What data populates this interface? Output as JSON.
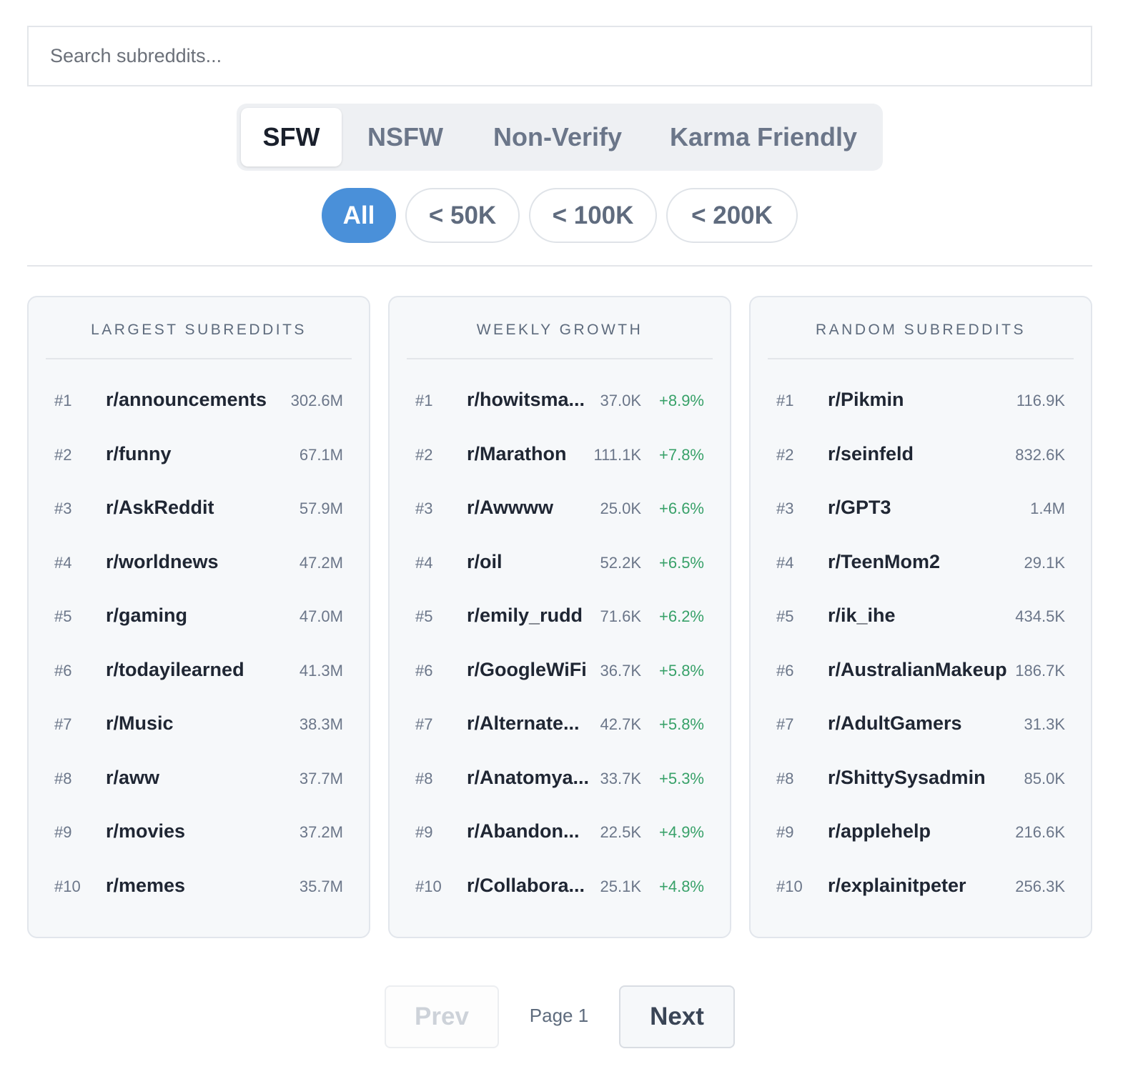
{
  "search": {
    "placeholder": "Search subreddits...",
    "value": ""
  },
  "tabs": [
    {
      "label": "SFW",
      "active": true
    },
    {
      "label": "NSFW",
      "active": false
    },
    {
      "label": "Non-Verify",
      "active": false
    },
    {
      "label": "Karma Friendly",
      "active": false
    }
  ],
  "size_filters": [
    {
      "label": "All",
      "active": true
    },
    {
      "label": "< 50K",
      "active": false
    },
    {
      "label": "< 100K",
      "active": false
    },
    {
      "label": "< 200K",
      "active": false
    }
  ],
  "panels": [
    {
      "title": "LARGEST SUBREDDITS",
      "rows": [
        {
          "rank": "#1",
          "name": "r/announcements",
          "count": "302.6M"
        },
        {
          "rank": "#2",
          "name": "r/funny",
          "count": "67.1M"
        },
        {
          "rank": "#3",
          "name": "r/AskReddit",
          "count": "57.9M"
        },
        {
          "rank": "#4",
          "name": "r/worldnews",
          "count": "47.2M"
        },
        {
          "rank": "#5",
          "name": "r/gaming",
          "count": "47.0M"
        },
        {
          "rank": "#6",
          "name": "r/todayilearned",
          "count": "41.3M"
        },
        {
          "rank": "#7",
          "name": "r/Music",
          "count": "38.3M"
        },
        {
          "rank": "#8",
          "name": "r/aww",
          "count": "37.7M"
        },
        {
          "rank": "#9",
          "name": "r/movies",
          "count": "37.2M"
        },
        {
          "rank": "#10",
          "name": "r/memes",
          "count": "35.7M"
        }
      ]
    },
    {
      "title": "WEEKLY GROWTH",
      "rows": [
        {
          "rank": "#1",
          "name": "r/howitsma...",
          "count": "37.0K",
          "growth": "+8.9%"
        },
        {
          "rank": "#2",
          "name": "r/Marathon",
          "count": "111.1K",
          "growth": "+7.8%"
        },
        {
          "rank": "#3",
          "name": "r/Awwww",
          "count": "25.0K",
          "growth": "+6.6%"
        },
        {
          "rank": "#4",
          "name": "r/oil",
          "count": "52.2K",
          "growth": "+6.5%"
        },
        {
          "rank": "#5",
          "name": "r/emily_rudd",
          "count": "71.6K",
          "growth": "+6.2%"
        },
        {
          "rank": "#6",
          "name": "r/GoogleWiFi",
          "count": "36.7K",
          "growth": "+5.8%"
        },
        {
          "rank": "#7",
          "name": "r/Alternate...",
          "count": "42.7K",
          "growth": "+5.8%"
        },
        {
          "rank": "#8",
          "name": "r/Anatomya...",
          "count": "33.7K",
          "growth": "+5.3%"
        },
        {
          "rank": "#9",
          "name": "r/Abandon...",
          "count": "22.5K",
          "growth": "+4.9%"
        },
        {
          "rank": "#10",
          "name": "r/Collabora...",
          "count": "25.1K",
          "growth": "+4.8%"
        }
      ]
    },
    {
      "title": "RANDOM SUBREDDITS",
      "rows": [
        {
          "rank": "#1",
          "name": "r/Pikmin",
          "count": "116.9K"
        },
        {
          "rank": "#2",
          "name": "r/seinfeld",
          "count": "832.6K"
        },
        {
          "rank": "#3",
          "name": "r/GPT3",
          "count": "1.4M"
        },
        {
          "rank": "#4",
          "name": "r/TeenMom2",
          "count": "29.1K"
        },
        {
          "rank": "#5",
          "name": "r/ik_ihe",
          "count": "434.5K"
        },
        {
          "rank": "#6",
          "name": "r/AustralianMakeup",
          "count": "186.7K"
        },
        {
          "rank": "#7",
          "name": "r/AdultGamers",
          "count": "31.3K"
        },
        {
          "rank": "#8",
          "name": "r/ShittySysadmin",
          "count": "85.0K"
        },
        {
          "rank": "#9",
          "name": "r/applehelp",
          "count": "216.6K"
        },
        {
          "rank": "#10",
          "name": "r/explainitpeter",
          "count": "256.3K"
        }
      ]
    }
  ],
  "pagination": {
    "prev_label": "Prev",
    "page_label": "Page 1",
    "next_label": "Next",
    "prev_disabled": true
  },
  "colors": {
    "accent": "#4a90d9",
    "growth": "#38a169"
  }
}
